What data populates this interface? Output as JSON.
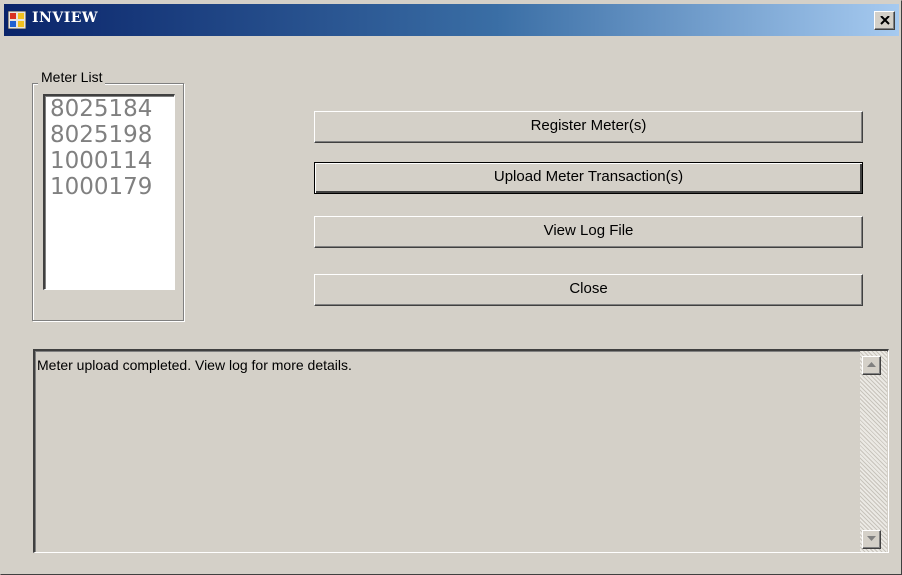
{
  "window": {
    "title": "INVIEW"
  },
  "meter_list": {
    "label": "Meter List",
    "items": [
      "8025184",
      "8025198",
      "1000114",
      "1000179"
    ]
  },
  "buttons": {
    "register": "Register Meter(s)",
    "upload": "Upload Meter Transaction(s)",
    "view_log": "View Log File",
    "close": "Close"
  },
  "log": {
    "message": "Meter upload completed. View log for more details."
  },
  "icons": {
    "app": "app-window-icon",
    "close": "close-icon",
    "scroll_up": "scroll-up-arrow-icon",
    "scroll_down": "scroll-down-arrow-icon"
  },
  "colors": {
    "titlebar_start": "#0a246a",
    "titlebar_end": "#a6caf0",
    "face": "#d4d0c8",
    "list_text": "#808080"
  }
}
